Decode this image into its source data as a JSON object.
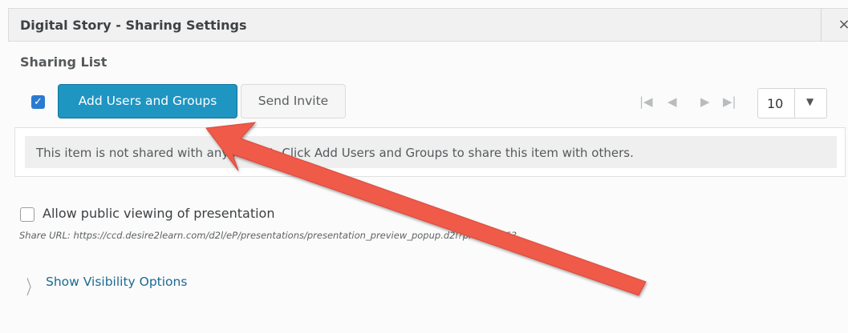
{
  "dialog": {
    "title": "Digital Story - Sharing Settings",
    "close_icon": "×"
  },
  "sharing": {
    "section_title": "Sharing List",
    "select_all_checked": true,
    "check_glyph": "✓",
    "add_button": "Add Users and Groups",
    "invite_button": "Send Invite",
    "pager": {
      "first_icon": "|◀",
      "prev_icon": "◀",
      "next_icon": "▶",
      "last_icon": "▶|",
      "page_size": "10",
      "dropdown_icon": "▼"
    },
    "notice": "This item is not shared with anyone yet. Click Add Users and Groups to share this item with others."
  },
  "public": {
    "checked": false,
    "label": "Allow public viewing of presentation",
    "share_url": "Share URL: https://ccd.desire2learn.com/d2l/eP/presentations/presentation_preview_popup.d2l?presId=363"
  },
  "visibility": {
    "chevron_icon": "〉",
    "link": "Show Visibility Options"
  },
  "colors": {
    "accent": "#1f95c2",
    "annotation_arrow": "#ef5a4a"
  }
}
